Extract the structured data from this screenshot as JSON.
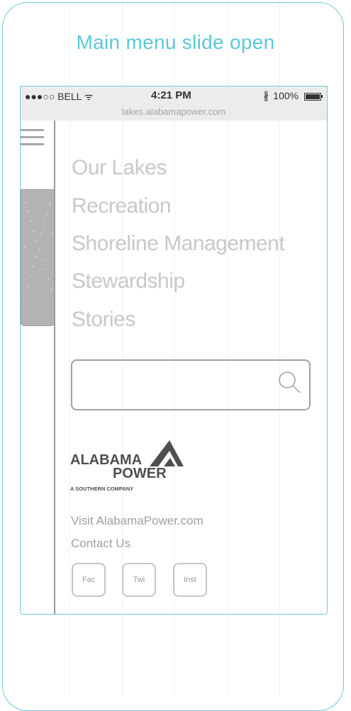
{
  "page_title": "Main menu slide open",
  "status_bar": {
    "carrier": "●●●○○ BELL ᯤ",
    "time": "4:21 PM",
    "bluetooth": "∦",
    "battery": "100%"
  },
  "url": "lakes.alabamapower.com",
  "menu": {
    "items": [
      {
        "label": "Our Lakes"
      },
      {
        "label": "Recreation"
      },
      {
        "label": "Shoreline Management"
      },
      {
        "label": "Stewardship"
      },
      {
        "label": "Stories"
      }
    ]
  },
  "search": {
    "placeholder": ""
  },
  "logo": {
    "line1": "ALABAMA",
    "line2": "POWER",
    "tagline": "A SOUTHERN COMPANY"
  },
  "links": {
    "visit": "Visit AlabamaPower.com",
    "contact": "Contact Us"
  },
  "social": [
    {
      "label": "Fac"
    },
    {
      "label": "Twi"
    },
    {
      "label": "Inst"
    }
  ],
  "colors": {
    "accent": "#5cc7dc",
    "frame": "#6fcbdb",
    "menu_text": "#c8c8c8",
    "logo_red": "#555555"
  }
}
